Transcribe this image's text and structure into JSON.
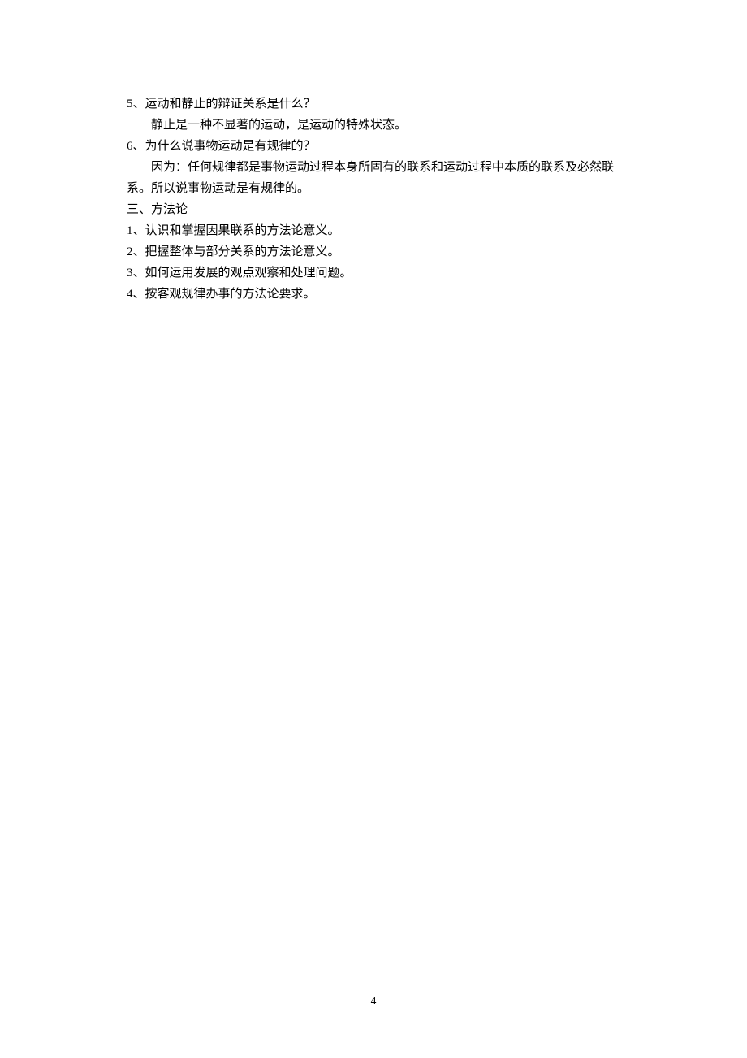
{
  "lines": [
    {
      "text": "5、运动和静止的辩证关系是什么？",
      "indented": false,
      "name": "question-5"
    },
    {
      "text": "静止是一种不显著的运动，是运动的特殊状态。",
      "indented": true,
      "name": "answer-5"
    },
    {
      "text": "6、为什么说事物运动是有规律的？",
      "indented": false,
      "name": "question-6"
    },
    {
      "text": "因为：任何规律都是事物运动过程本身所固有的联系和运动过程中本质的联系及必然联",
      "indented": true,
      "name": "answer-6-line-1"
    },
    {
      "text": "系。所以说事物运动是有规律的。",
      "indented": false,
      "name": "answer-6-line-2"
    },
    {
      "text": "三、方法论",
      "indented": false,
      "name": "section-3-heading"
    },
    {
      "text": "1、认识和掌握因果联系的方法论意义。",
      "indented": false,
      "name": "method-item-1"
    },
    {
      "text": "2、把握整体与部分关系的方法论意义。",
      "indented": false,
      "name": "method-item-2"
    },
    {
      "text": "3、如何运用发展的观点观察和处理问题。",
      "indented": false,
      "name": "method-item-3"
    },
    {
      "text": "4、按客观规律办事的方法论要求。",
      "indented": false,
      "name": "method-item-4"
    }
  ],
  "pageNumber": "4"
}
